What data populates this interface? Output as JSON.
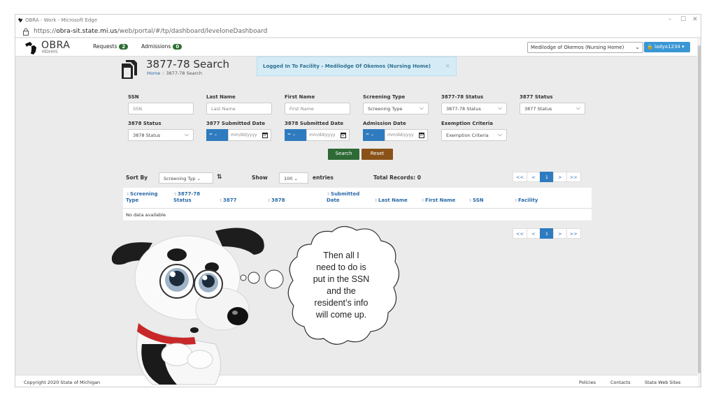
{
  "browser": {
    "title": "OBRA - Work - Microsoft Edge",
    "url_pre": "https://",
    "url_host": "obra-sit.state.mi.us",
    "url_path": "/web/portal/#/tp/dashboard/leveloneDashboard"
  },
  "header": {
    "logo_text": "OBRA",
    "logo_sub": "MDHHS",
    "nav": [
      {
        "label": "Requests",
        "badge": "2"
      },
      {
        "label": "Admissions",
        "badge": "0"
      }
    ],
    "facility": "Medilodge of Okemos (Nursing Home)",
    "user": "ladya1234"
  },
  "page": {
    "title": "3877-78 Search",
    "crumb_home": "Home",
    "crumb_sep": "/",
    "crumb_current": "3877-78 Search",
    "alert": "Logged In To Facility - Medilodge Of Okemos (Nursing Home)",
    "alert_close": "×"
  },
  "filters": {
    "ssn_label": "SSN",
    "ssn_placeholder": "SSN",
    "last_label": "Last Name",
    "last_placeholder": "Last Name",
    "first_label": "First Name",
    "first_placeholder": "First Name",
    "screening_label": "Screening Type",
    "screening_value": "Screening Type",
    "status78_label": "3877-78 Status",
    "status78_value": "3877-78 Status",
    "status77_label": "3877 Status",
    "status77_value": "3877 Status",
    "status3878_label": "3878 Status",
    "status3878_value": "3878 Status",
    "sub3877_label": "3877 Submitted Date",
    "sub3878_label": "3878 Submitted Date",
    "admission_label": "Admission Date",
    "exemption_label": "Exemption Criteria",
    "exemption_value": "Exemption Criteria",
    "op": "=",
    "date_placeholder": "mm/dd/yyyy",
    "search_btn": "Search",
    "reset_btn": "Reset"
  },
  "results": {
    "sort_label": "Sort By",
    "sort_value": "Screening Typ",
    "show_label": "Show",
    "show_value": "100",
    "entries_label": "entries",
    "total_label": "Total Records: 0",
    "pager": [
      "<<",
      "<",
      "1",
      ">",
      ">>"
    ],
    "columns": [
      "Screening Type",
      "3877-78 Status",
      "3877",
      "3878",
      "Submitted Date",
      "Last Name",
      "First Name",
      "SSN",
      "Facility"
    ],
    "empty_text": "No data available"
  },
  "footer": {
    "copyright": "Copyright 2020 State of Michigan",
    "links": [
      "Policies",
      "Contacts",
      "State Web Sites"
    ]
  },
  "bubble": {
    "lines": [
      "Then all I",
      "need to do is",
      "put in the SSN",
      "and the",
      "resident’s info",
      "will come up."
    ]
  },
  "colors": {
    "primary": "#2f7bbf",
    "search": "#2d6a35",
    "reset": "#8a5219",
    "collar": "#c8282a"
  }
}
